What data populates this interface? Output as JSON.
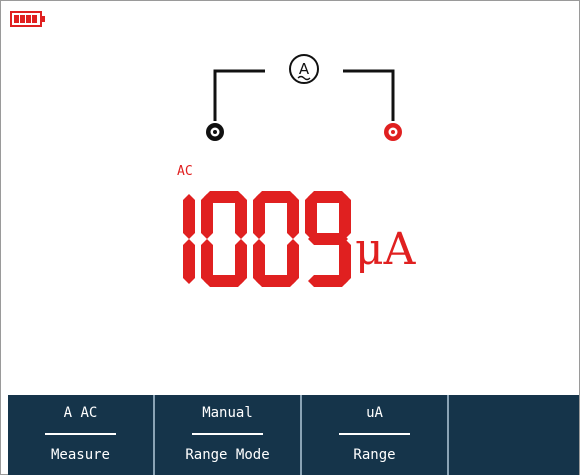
{
  "battery": {
    "icon": "battery-icon",
    "level": 1.0,
    "color": "#e02020"
  },
  "diagram": {
    "meter_icon": "ammeter-icon",
    "meter_symbol": "A",
    "com_terminal_icon": "com-terminal-icon",
    "input_terminal_icon": "input-terminal-icon"
  },
  "display": {
    "mode": "AC",
    "reading": "1009",
    "unit": "μA",
    "color": "#e02020"
  },
  "softkeys": [
    {
      "value": "A AC",
      "label": "Measure"
    },
    {
      "value": "Manual",
      "label": "Range Mode"
    },
    {
      "value": "uA",
      "label": "Range"
    }
  ],
  "colors": {
    "accent": "#e02020",
    "softkey_bg": "#15344a",
    "divider": "#8aa3b5"
  }
}
